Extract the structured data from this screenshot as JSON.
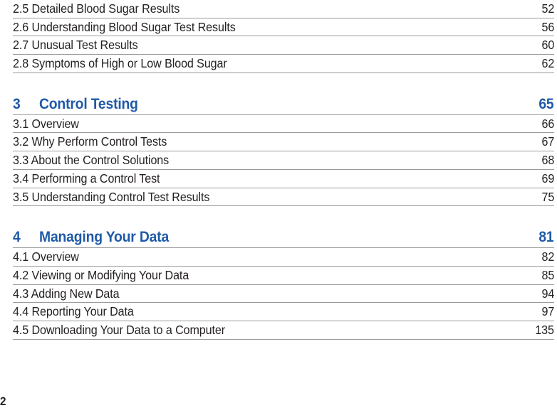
{
  "document": {
    "type": "table-of-contents",
    "folio": "2",
    "colors": {
      "heading_blue": "#1F5AA8",
      "body_text": "#231F20",
      "rule_gray": "#9A9A9A",
      "background": "#FFFFFF"
    }
  },
  "toc": {
    "groups": [
      {
        "heading": null,
        "entries": [
          {
            "number": "2.5",
            "title": "Detailed Blood Sugar Results",
            "page": "52"
          },
          {
            "number": "2.6",
            "title": "Understanding Blood Sugar Test Results",
            "page": "56"
          },
          {
            "number": "2.7",
            "title": "Unusual Test Results",
            "page": "60"
          },
          {
            "number": "2.8",
            "title": "Symptoms of High or Low Blood Sugar",
            "page": "62"
          }
        ]
      },
      {
        "heading": {
          "number": "3",
          "title": "Control Testing",
          "page": "65"
        },
        "entries": [
          {
            "number": "3.1",
            "title": "Overview",
            "page": "66"
          },
          {
            "number": "3.2",
            "title": "Why Perform Control Tests",
            "page": "67"
          },
          {
            "number": "3.3",
            "title": "About the Control Solutions",
            "page": "68"
          },
          {
            "number": "3.4",
            "title": "Performing a Control Test",
            "page": "69"
          },
          {
            "number": "3.5",
            "title": "Understanding Control Test Results",
            "page": "75"
          }
        ]
      },
      {
        "heading": {
          "number": "4",
          "title": "Managing Your Data",
          "page": "81"
        },
        "entries": [
          {
            "number": "4.1",
            "title": "Overview",
            "page": "82"
          },
          {
            "number": "4.2",
            "title": "Viewing or Modifying Your Data",
            "page": "85"
          },
          {
            "number": "4.3",
            "title": "Adding New Data",
            "page": "94"
          },
          {
            "number": "4.4",
            "title": "Reporting Your Data",
            "page": "97"
          },
          {
            "number": "4.5",
            "title": "Downloading Your Data to a Computer",
            "page": "135"
          }
        ]
      }
    ]
  }
}
